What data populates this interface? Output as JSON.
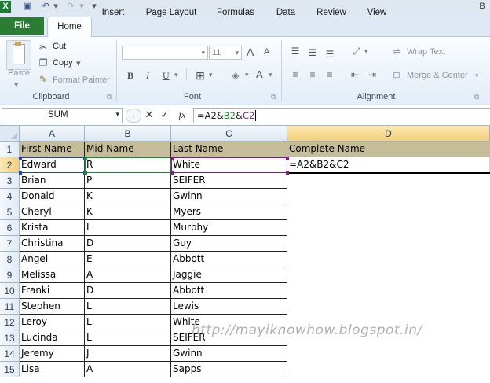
{
  "qat": {
    "excel_icon": "excel-icon",
    "save_icon": "save-icon",
    "undo_icon": "undo-icon",
    "redo_icon": "redo-icon",
    "title_fragment": "B"
  },
  "tabs": [
    "File",
    "Home",
    "Insert",
    "Page Layout",
    "Formulas",
    "Data",
    "Review",
    "View"
  ],
  "clipboard": {
    "cut": "Cut",
    "copy": "Copy",
    "format_painter": "Format Painter",
    "paste": "Paste",
    "label": "Clipboard"
  },
  "font": {
    "name_value": "",
    "size_value": "11",
    "label": "Font",
    "bold": "B",
    "italic": "I",
    "underline": "U",
    "grow": "A",
    "shrink": "A",
    "font_color": "A"
  },
  "alignment": {
    "wrap_text": "Wrap Text",
    "merge_center": "Merge & Center",
    "label": "Alignment"
  },
  "formula_bar": {
    "name_box": "SUM",
    "cancel": "✕",
    "enter": "✓",
    "fx": "fx",
    "formula_parts": [
      "=A2&",
      "B2",
      "&",
      "C2"
    ]
  },
  "columns": [
    "A",
    "B",
    "C",
    "D"
  ],
  "rows": [
    [
      "First Name",
      "Mid Name",
      "Last Name",
      "Complete Name"
    ],
    [
      "Edward",
      "R",
      "White",
      "=A2&B2&C2"
    ],
    [
      "Brian",
      "P",
      "SEIFER",
      ""
    ],
    [
      "Donald",
      "K",
      "Gwinn",
      ""
    ],
    [
      "Cheryl",
      "K",
      "Myers",
      ""
    ],
    [
      "Krista",
      "L",
      "Murphy",
      ""
    ],
    [
      "Christina",
      "D",
      "Guy",
      ""
    ],
    [
      "Angel",
      "E",
      "Abbott",
      ""
    ],
    [
      "Melissa",
      "A",
      "Jaggie",
      ""
    ],
    [
      "Franki",
      "D",
      "Abbott",
      ""
    ],
    [
      "Stephen",
      "L",
      "Lewis",
      ""
    ],
    [
      "Leroy",
      "L",
      "White",
      ""
    ],
    [
      "Lucinda",
      "L",
      "SEIFER",
      ""
    ],
    [
      "Jeremy",
      "J",
      "Gwinn",
      ""
    ],
    [
      "Lisa",
      "A",
      "Sapps",
      ""
    ]
  ],
  "row_numbers": [
    "1",
    "2",
    "3",
    "4",
    "5",
    "6",
    "7",
    "8",
    "9",
    "10",
    "11",
    "12",
    "13",
    "14",
    "15"
  ],
  "watermark": "http://mayiknowhow.blogspot.in/",
  "colors": {
    "header_fill": "#c4bd97",
    "ref_blue": "#1f3fc4",
    "ref_green": "#1a8a2a",
    "ref_purple": "#8a1a8a",
    "file_tab": "#2a7d33"
  }
}
